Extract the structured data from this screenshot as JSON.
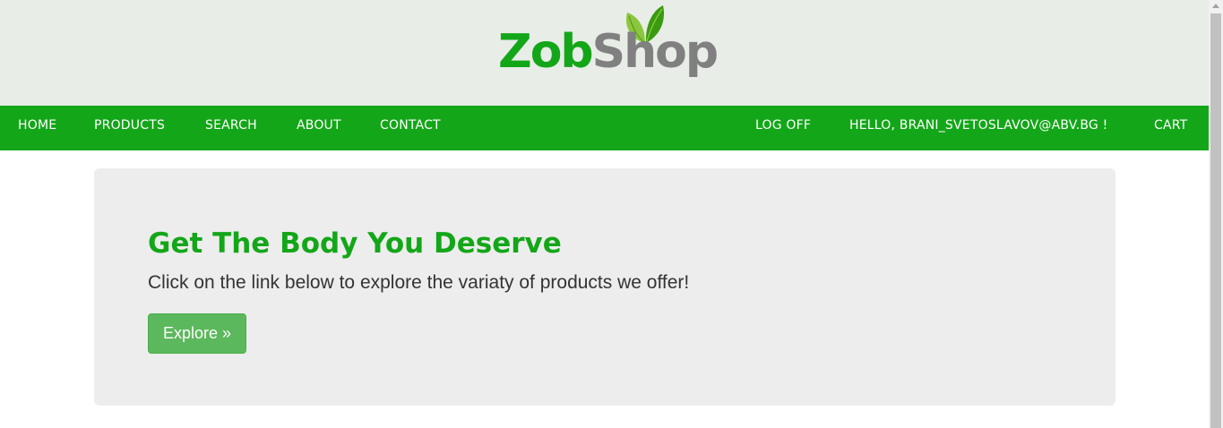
{
  "logo": {
    "part1": "Zob",
    "part2": "Shop",
    "colors": {
      "primary": "#14a619",
      "secondary": "#808080",
      "leaf_dark": "#3a9a10",
      "leaf_light": "#8cc63f"
    }
  },
  "nav": {
    "left": [
      {
        "label": "HOME"
      },
      {
        "label": "PRODUCTS"
      },
      {
        "label": "SEARCH"
      },
      {
        "label": "ABOUT"
      },
      {
        "label": "CONTACT"
      }
    ],
    "right": [
      {
        "label": "LOG OFF"
      },
      {
        "label": "HELLO, BRANI_SVETOSLAVOV@ABV.BG !"
      },
      {
        "label": "CART"
      }
    ],
    "background_color": "#14a619"
  },
  "hero": {
    "title": "Get The Body You Deserve",
    "text": "Click on the link below to explore the variaty of products we offer!",
    "button_label": "Explore »",
    "button_color": "#5cb85c"
  }
}
